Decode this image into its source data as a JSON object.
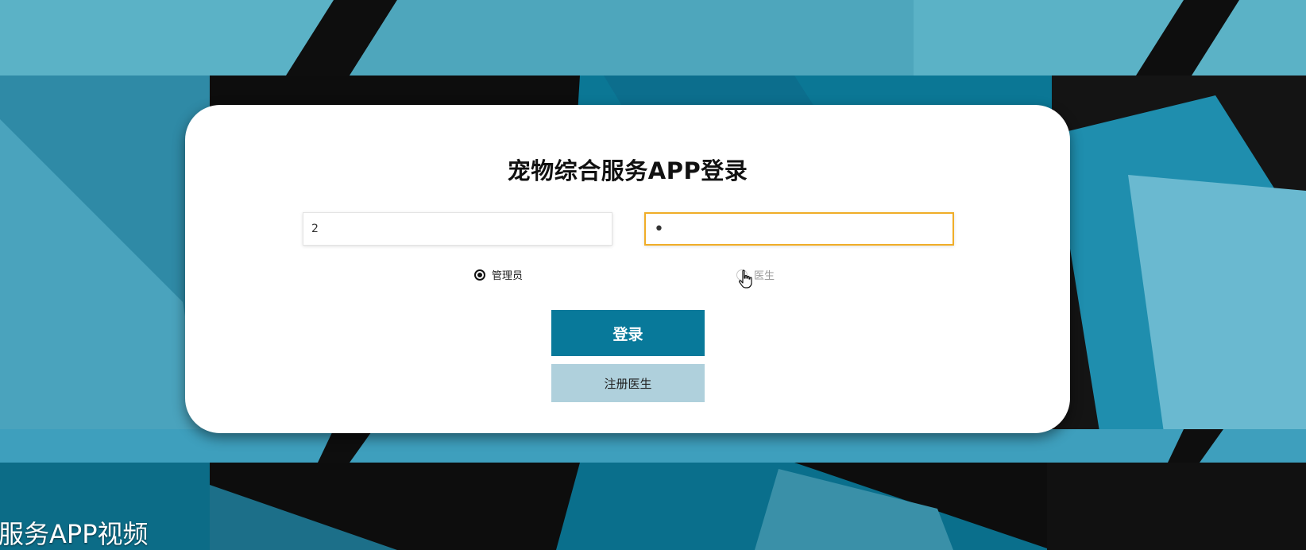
{
  "login": {
    "title": "宠物综合服务APP登录",
    "username_value": "2",
    "password_value": "•",
    "roles": [
      {
        "label": "管理员",
        "selected": true
      },
      {
        "label": "医生",
        "selected": false
      }
    ],
    "login_button": "登录",
    "register_button": "注册医生"
  },
  "caption": "服务APP视频",
  "colors": {
    "primary": "#08799a",
    "secondary": "#afd0dc",
    "focus_border": "#f0ad28",
    "background_teal": "#49a7c1",
    "background_dark": "#0f0f0f"
  },
  "icons": {
    "pointer": "hand-pointer-icon"
  }
}
